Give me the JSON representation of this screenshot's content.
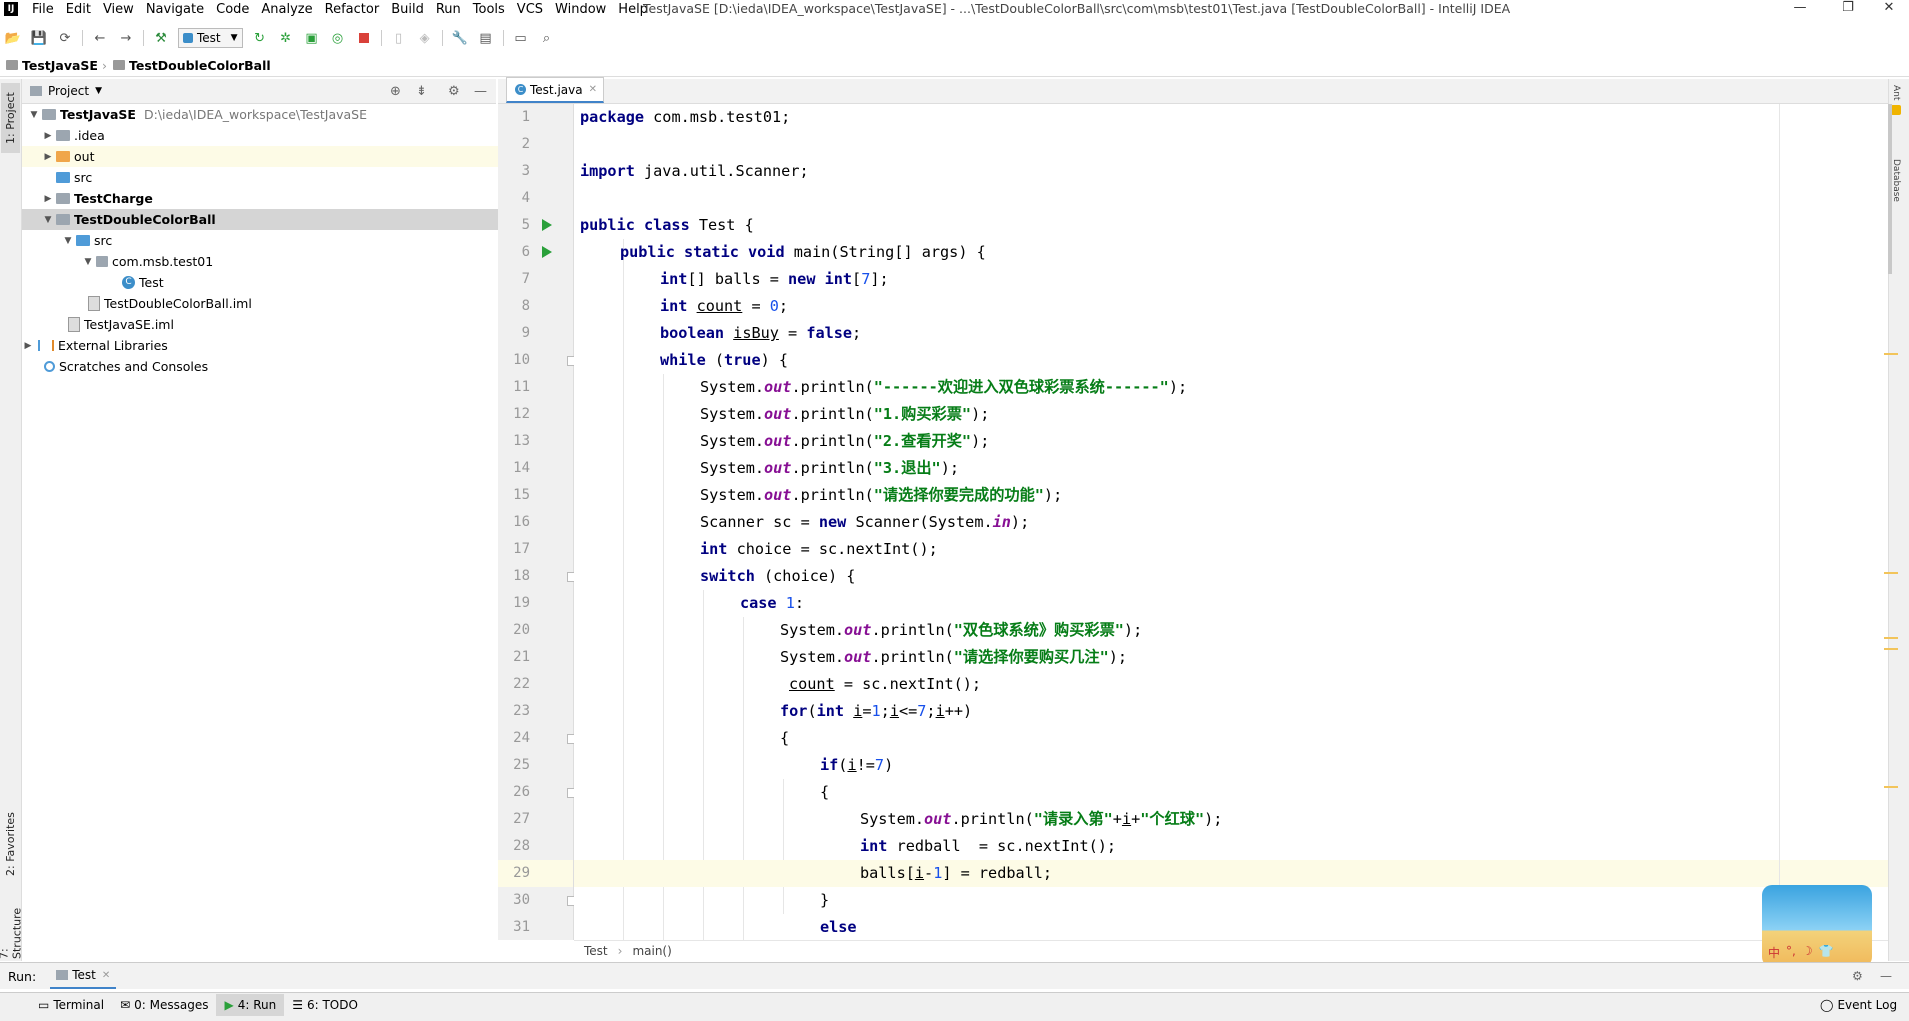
{
  "app": {
    "window_title": "TestJavaSE [D:\\ieda\\IDEA_workspace\\TestJavaSE] - ...\\TestDoubleColorBall\\src\\com\\msb\\test01\\Test.java [TestDoubleColorBall] - IntelliJ IDEA",
    "menu": [
      "File",
      "Edit",
      "View",
      "Navigate",
      "Code",
      "Analyze",
      "Refactor",
      "Build",
      "Run",
      "Tools",
      "VCS",
      "Window",
      "Help"
    ]
  },
  "toolbar": {
    "run_config": "Test"
  },
  "navbar": {
    "crumbs": [
      "TestJavaSE",
      "TestDoubleColorBall"
    ]
  },
  "left_strip": {
    "project": "1: Project",
    "favorites": "2: Favorites",
    "structure": "7: Structure"
  },
  "project_panel": {
    "title": "Project",
    "tree": [
      {
        "label": "TestJavaSE",
        "path": "D:\\ieda\\IDEA_workspace\\TestJavaSE"
      },
      {
        "label": ".idea"
      },
      {
        "label": "out"
      },
      {
        "label": "src"
      },
      {
        "label": "TestCharge"
      },
      {
        "label": "TestDoubleColorBall"
      },
      {
        "label": "src"
      },
      {
        "label": "com.msb.test01"
      },
      {
        "label": "Test"
      },
      {
        "label": "TestDoubleColorBall.iml"
      },
      {
        "label": "TestJavaSE.iml"
      },
      {
        "label": "External Libraries"
      },
      {
        "label": "Scratches and Consoles"
      }
    ]
  },
  "editor": {
    "tab": "Test.java",
    "lines": [
      "1",
      "2",
      "3",
      "4",
      "5",
      "6",
      "7",
      "8",
      "9",
      "10",
      "11",
      "12",
      "13",
      "14",
      "15",
      "16",
      "17",
      "18",
      "19",
      "20",
      "21",
      "22",
      "23",
      "24",
      "25",
      "26",
      "27",
      "28",
      "29",
      "30",
      "31"
    ],
    "code": {
      "l1a": "package",
      "l1b": " com.msb.test01;",
      "l3a": "import",
      "l3b": " java.util.Scanner;",
      "l5a": "public class",
      "l5b": " Test {",
      "l6a": "public static void",
      "l6b": " main(String[] args) {",
      "l7a": "int",
      "l7b": "[] balls = ",
      "l7c": "new int",
      "l7d": "[",
      "l7e": "7",
      "l7f": "];",
      "l8a": "int",
      "l8b": "count",
      "l8c": " = ",
      "l8d": "0",
      "l8e": ";",
      "l9a": "boolean",
      "l9b": "isBuy",
      "l9c": " = ",
      "l9d": "false",
      "l9e": ";",
      "l10a": "while",
      "l10b": " (",
      "l10c": "true",
      "l10d": ") {",
      "sys": "System.",
      "out": "out",
      "println": ".println(",
      "s11": "\"------欢迎进入双色球彩票系统------\"",
      "s12": "\"1.购买彩票\"",
      "s13": "\"2.查看开奖\"",
      "s14": "\"3.退出\"",
      "s15": "\"请选择你要完成的功能\"",
      "end": ");",
      "l16a": "Scanner sc = ",
      "l16b": "new",
      "l16c": " Scanner(System.",
      "l16d": "in",
      "l16e": ");",
      "l17a": "int",
      "l17b": " choice = sc.nextInt();",
      "l18a": "switch",
      "l18b": " (choice) {",
      "l19a": "case",
      "l19b": "1",
      "l19c": ":",
      "s20": "\"双色球系统》购买彩票\"",
      "s21": "\"请选择你要购买几注\"",
      "l22a": "count",
      "l22b": " = sc.nextInt();",
      "l23a": "for",
      "l23b": "(",
      "l23c": "int",
      "l23d": "i",
      "l23e": "=",
      "l23f": "1",
      "l23g": ";",
      "l23h": "i",
      "l23i": "<=",
      "l23j": "7",
      "l23k": ";",
      "l23l": "i",
      "l23m": "++)",
      "l24": "{",
      "l25a": "if",
      "l25b": "(",
      "l25c": "i",
      "l25d": "!=",
      "l25e": "7",
      "l25f": ")",
      "l26": "{",
      "s27a": "\"请录入第\"",
      "l27b": "+",
      "l27c": "i",
      "l27d": "+",
      "s27e": "\"个红球\"",
      "l28a": "int",
      "l28b": " redball  = sc.nextInt();",
      "l29a": "balls[",
      "l29b": "i",
      "l29c": "-",
      "l29d": "1",
      "l29e": "] = redball;",
      "l30": "}",
      "l31a": "else"
    },
    "breadcrumb": [
      "Test",
      "main()"
    ]
  },
  "run": {
    "label": "Run:",
    "tab": "Test"
  },
  "toolwindows": [
    "Terminal",
    "0: Messages",
    "4: Run",
    "6: TODO"
  ],
  "event_log": "Event Log",
  "colors": {
    "keyword": "#000080",
    "string": "#067d17",
    "number": "#1750eb",
    "field": "#871094",
    "run_marker": "#2aa03a"
  }
}
